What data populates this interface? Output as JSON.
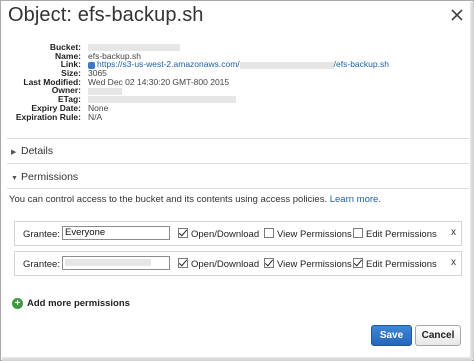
{
  "dialog": {
    "title": "Object: efs-backup.sh",
    "close_icon": "close-icon"
  },
  "properties": [
    {
      "label": "Bucket:",
      "value": ""
    },
    {
      "label": "Name:",
      "value": "efs-backup.sh"
    },
    {
      "label": "Link:",
      "value_prefix": "https://s3-us-west-2.amazonaws.com/",
      "value_suffix": "/efs-backup.sh"
    },
    {
      "label": "Size:",
      "value": "3065"
    },
    {
      "label": "Last Modified:",
      "value": "Wed Dec 02 14:30:20 GMT-800 2015"
    },
    {
      "label": "Owner:",
      "value": ""
    },
    {
      "label": "ETag:",
      "value": ""
    },
    {
      "label": "Expiry Date:",
      "value": "None"
    },
    {
      "label": "Expiration Rule:",
      "value": "N/A"
    }
  ],
  "sections": {
    "details": "Details",
    "permissions": "Permissions"
  },
  "permissions": {
    "info_text": "You can control access to the bucket and its contents using access policies.",
    "learn_more": "Learn more",
    "grantee_label": "Grantee:",
    "open_download_label": "Open/Download",
    "view_permissions_label": "View Permissions",
    "edit_permissions_label": "Edit Permissions",
    "remove_label": "x",
    "rows": [
      {
        "grantee": "Everyone",
        "open_download": true,
        "view_permissions": false,
        "edit_permissions": false
      },
      {
        "grantee": "",
        "open_download": true,
        "view_permissions": true,
        "edit_permissions": true
      }
    ],
    "add_more": "Add more permissions"
  },
  "buttons": {
    "save": "Save",
    "cancel": "Cancel"
  },
  "colors": {
    "link": "#1a5fa8",
    "save_button": "#2f74c8",
    "add_icon": "#3c9a3c"
  }
}
